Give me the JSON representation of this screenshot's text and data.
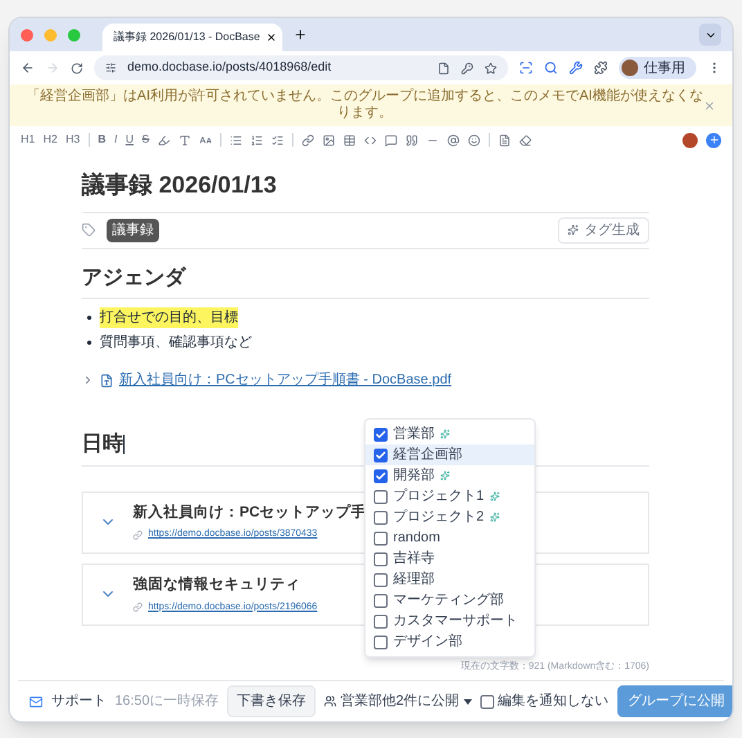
{
  "tab": {
    "title": "議事録 2026/01/13 - DocBase"
  },
  "address_bar": {
    "url": "demo.docbase.io/posts/4018968/edit"
  },
  "profile": {
    "label": "仕事用"
  },
  "banner": {
    "text": "「経営企画部」はAI利用が許可されていません。このグループに追加すると、このメモでAI機能が使えなくなります。"
  },
  "toolbar": {
    "headings": [
      "H1",
      "H2",
      "H3"
    ],
    "formats": [
      "B",
      "I",
      "U",
      "S"
    ]
  },
  "editor": {
    "title": "議事録 2026/01/13",
    "tags": [
      {
        "label": "議事録"
      }
    ],
    "tag_generate": "タグ生成",
    "agenda_heading": "アジェンダ",
    "bullets": [
      {
        "text": "打合せでの目的、目標",
        "highlighted": true
      },
      {
        "text": "質問事項、確認事項など",
        "highlighted": false
      }
    ],
    "attachment": {
      "name": "新入社員向け：PCセットアップ手順書 - DocBase.pdf",
      "expanded": false
    },
    "date_heading": "日時",
    "linked_posts": [
      {
        "title": "新入社員向け：PCセットアップ手",
        "url": "https://demo.docbase.io/posts/3870433",
        "expanded": true
      },
      {
        "title": "強固な情報セキュリティ",
        "url": "https://demo.docbase.io/posts/2196066",
        "expanded": true
      }
    ],
    "char_count": "現在の文字数：921 (Markdown含む：1706)"
  },
  "groups": [
    {
      "name": "営業部",
      "checked": true,
      "ai_allowed": true,
      "selected": false
    },
    {
      "name": "経営企画部",
      "checked": true,
      "ai_allowed": false,
      "selected": true
    },
    {
      "name": "開発部",
      "checked": true,
      "ai_allowed": true,
      "selected": false
    },
    {
      "name": "プロジェクト1",
      "checked": false,
      "ai_allowed": true,
      "selected": false
    },
    {
      "name": "プロジェクト2",
      "checked": false,
      "ai_allowed": true,
      "selected": false
    },
    {
      "name": "random",
      "checked": false,
      "ai_allowed": false,
      "selected": false
    },
    {
      "name": "吉祥寺",
      "checked": false,
      "ai_allowed": false,
      "selected": false
    },
    {
      "name": "経理部",
      "checked": false,
      "ai_allowed": false,
      "selected": false
    },
    {
      "name": "マーケティング部",
      "checked": false,
      "ai_allowed": false,
      "selected": false
    },
    {
      "name": "カスタマーサポート",
      "checked": false,
      "ai_allowed": false,
      "selected": false
    },
    {
      "name": "デザイン部",
      "checked": false,
      "ai_allowed": false,
      "selected": false
    }
  ],
  "footer": {
    "support": "サポート",
    "autosave": "16:50に一時保存",
    "draft_button": "下書き保存",
    "visibility": "営業部他2件に公開",
    "notify": {
      "label": "編集を通知しない",
      "checked": false
    },
    "publish_button": "グループに公開"
  }
}
